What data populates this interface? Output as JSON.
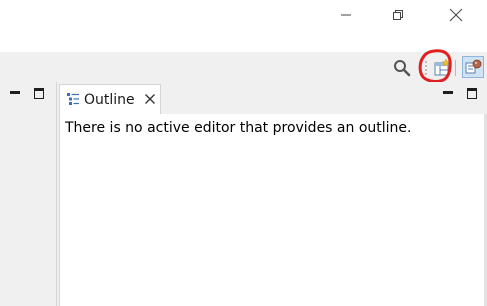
{
  "window": {
    "controls": {
      "minimize_icon": "minimize-icon",
      "maximize_icon": "restore-icon",
      "close_icon": "close-icon"
    }
  },
  "toolbar": {
    "search_icon": "search-icon",
    "open_perspective_icon": "open-perspective-icon",
    "java_perspective_icon": "java-perspective-icon",
    "annotation_color": "#e02020"
  },
  "outline_view": {
    "tab_label": "Outline",
    "message": "There is no active editor that provides an outline."
  },
  "colors": {
    "background": "#f0f0f0",
    "panel": "#ffffff",
    "accent": "#cfe3f5"
  }
}
